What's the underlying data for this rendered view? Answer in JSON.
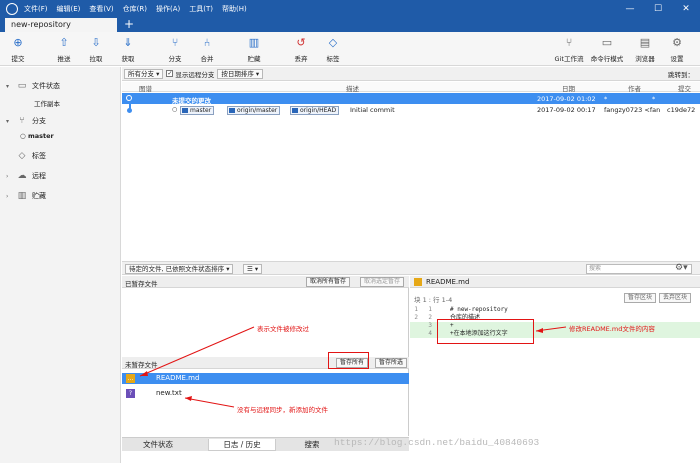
{
  "window": {
    "menus": [
      "文件(F)",
      "编辑(E)",
      "查看(V)",
      "仓库(R)",
      "操作(A)",
      "工具(T)",
      "帮助(H)"
    ],
    "controls": {
      "minimize": "—",
      "maximize": "☐",
      "close": "✕"
    },
    "tab": "new-repository",
    "tab_add": "+"
  },
  "toolbar": {
    "commit": "提交",
    "push": "推送",
    "pull": "拉取",
    "fetch": "获取",
    "branch": "分支",
    "merge": "合并",
    "stash": "贮藏",
    "discard": "丢弃",
    "tag": "标签",
    "gitflow": "Git工作流",
    "terminal": "命令行模式",
    "explorer": "浏览器",
    "settings": "设置"
  },
  "sidebar": {
    "file_status": "文件状态",
    "working_copy": "工作副本",
    "branches": "分支",
    "current_branch": "master",
    "tags": "标签",
    "remotes": "远程",
    "stashes": "贮藏"
  },
  "filter": {
    "all_branches": "所有分支",
    "show_remote": "显示远程分支",
    "sort": "按日期排序",
    "jump_to": "跳转到："
  },
  "columns": {
    "graph": "图谱",
    "description": "描述",
    "date": "日期",
    "author": "作者",
    "commit": "提交"
  },
  "commits": [
    {
      "description": "未提交的更改",
      "date": "2017-09-02 01:02",
      "author": "*",
      "hash": "*"
    },
    {
      "refs": [
        "master",
        "origin/master",
        "origin/HEAD"
      ],
      "description": "Initial commit",
      "date": "2017-09-02 00:17",
      "author": "fangzy0723 <fan",
      "hash": "c19de72"
    }
  ],
  "filelist_bar": {
    "sort_label": "待定的文件, 已依照文件状态排序",
    "view_icon": "☰",
    "search_placeholder": "搜索"
  },
  "staged": {
    "title": "已暂存文件",
    "unstage_all": "取消所有暂存",
    "unstage_selected": "取消选定暂存"
  },
  "unstaged": {
    "title": "未暂存文件",
    "stage_all": "暂存所有",
    "stage_selected": "暂存所选",
    "files": [
      {
        "name": "README.md",
        "status": "modified",
        "badge": "…"
      },
      {
        "name": "new.txt",
        "status": "untracked",
        "badge": "?"
      }
    ]
  },
  "bottom_tabs": [
    "文件状态",
    "日志 / 历史",
    "搜索"
  ],
  "diff": {
    "filename": "README.md",
    "hunk": "块 1 : 行 1-4",
    "stage_hunk": "暂存区块",
    "discard_hunk": "丢弃区块",
    "lines": [
      {
        "old": "1",
        "new": "1",
        "text": "# new-repository",
        "type": "ctx"
      },
      {
        "old": "2",
        "new": "2",
        "text": "仓库的描述",
        "type": "ctx"
      },
      {
        "old": "",
        "new": "3",
        "text": "+",
        "type": "add"
      },
      {
        "old": "",
        "new": "4",
        "text": "+在本地添加这行文字",
        "type": "add"
      }
    ]
  },
  "annotations": {
    "modified_note": "表示文件被修改过",
    "untracked_note": "没有与远程同步，新添加的文件",
    "diff_note": "修改README.md文件的内容"
  },
  "watermark": "https://blog.csdn.net/baidu_40840693",
  "colors": {
    "titlebar": "#1f5ba8",
    "selection": "#3d8ef0",
    "annotation": "#e21414"
  }
}
